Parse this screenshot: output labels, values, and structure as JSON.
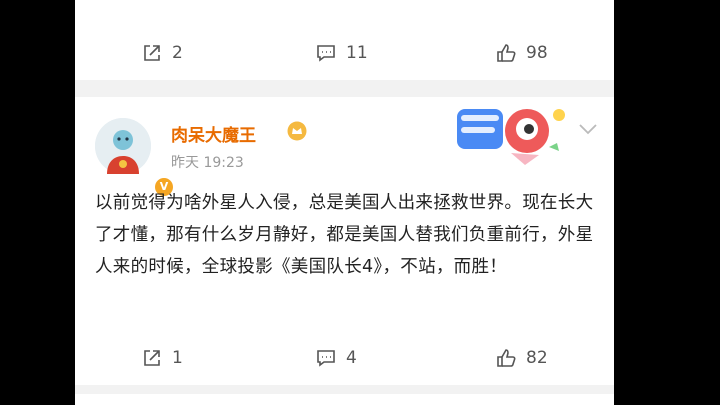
{
  "top_post": {
    "actions": {
      "share_count": "2",
      "comment_count": "11",
      "like_count": "98"
    }
  },
  "post": {
    "username": "肉呆大魔王",
    "time": "昨天 19:23",
    "text": "以前觉得为啥外星人入侵，总是美国人出来拯救世界。现在长大了才懂，那有什么岁月静好，都是美国人替我们负重前行，外星人来的时候，全球投影《美国队长4》，不站，而胜！",
    "actions": {
      "share_count": "1",
      "comment_count": "4",
      "like_count": "82"
    }
  },
  "icons": {
    "share": "share-icon",
    "comment": "comment-icon",
    "like": "like-icon",
    "verified": "verified-badge-icon",
    "crown": "crown-icon",
    "chevron": "chevron-down-icon"
  },
  "colors": {
    "username": "#e86b00",
    "background": "#f2f2f2",
    "card": "#ffffff",
    "badge": "#f5a623"
  }
}
